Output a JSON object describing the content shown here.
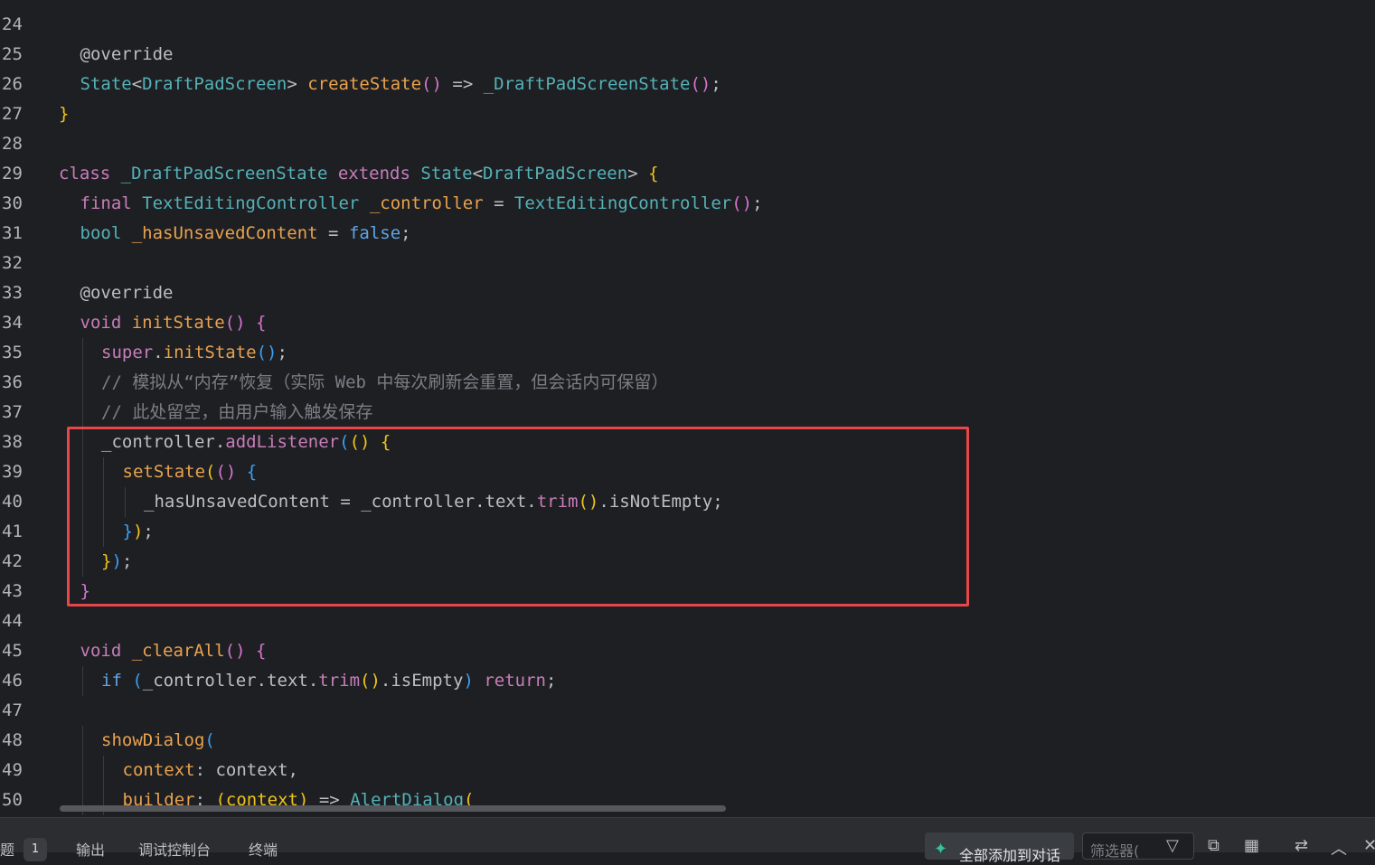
{
  "editor": {
    "lines": [
      {
        "num": "24",
        "indent": 0,
        "tokens": []
      },
      {
        "num": "25",
        "indent": 1,
        "tokens": [
          [
            "t-ann",
            "@override"
          ]
        ]
      },
      {
        "num": "26",
        "indent": 1,
        "tokens": [
          [
            "t-type",
            "State"
          ],
          [
            "t-op",
            "<"
          ],
          [
            "t-type",
            "DraftPadScreen"
          ],
          [
            "t-op",
            "> "
          ],
          [
            "t-call",
            "createState"
          ],
          [
            "t-p",
            "()"
          ],
          [
            "t-op",
            " => "
          ],
          [
            "t-type",
            "_DraftPadScreenState"
          ],
          [
            "t-p",
            "()"
          ],
          [
            "t-op",
            ";"
          ]
        ]
      },
      {
        "num": "27",
        "indent": 0,
        "tokens": [
          [
            "t-y",
            "}"
          ]
        ]
      },
      {
        "num": "28",
        "indent": 0,
        "tokens": []
      },
      {
        "num": "29",
        "indent": 0,
        "tokens": [
          [
            "t-kw",
            "class "
          ],
          [
            "t-type",
            "_DraftPadScreenState "
          ],
          [
            "t-kw",
            "extends "
          ],
          [
            "t-type",
            "State"
          ],
          [
            "t-op",
            "<"
          ],
          [
            "t-type",
            "DraftPadScreen"
          ],
          [
            "t-op",
            "> "
          ],
          [
            "t-y",
            "{"
          ]
        ]
      },
      {
        "num": "30",
        "indent": 1,
        "tokens": [
          [
            "t-kw",
            "final "
          ],
          [
            "t-type",
            "TextEditingController "
          ],
          [
            "t-named",
            "_controller"
          ],
          [
            "t-op",
            " = "
          ],
          [
            "t-type",
            "TextEditingController"
          ],
          [
            "t-p",
            "()"
          ],
          [
            "t-op",
            ";"
          ]
        ]
      },
      {
        "num": "31",
        "indent": 1,
        "tokens": [
          [
            "t-type",
            "bool "
          ],
          [
            "t-named",
            "_hasUnsavedContent"
          ],
          [
            "t-op",
            " = "
          ],
          [
            "t-kw2",
            "false"
          ],
          [
            "t-op",
            ";"
          ]
        ]
      },
      {
        "num": "32",
        "indent": 0,
        "tokens": []
      },
      {
        "num": "33",
        "indent": 1,
        "tokens": [
          [
            "t-ann",
            "@override"
          ]
        ]
      },
      {
        "num": "34",
        "indent": 1,
        "tokens": [
          [
            "t-kw",
            "void "
          ],
          [
            "t-call",
            "initState"
          ],
          [
            "t-p",
            "() "
          ],
          [
            "t-p",
            "{"
          ]
        ]
      },
      {
        "num": "35",
        "indent": 2,
        "tokens": [
          [
            "t-kw",
            "super"
          ],
          [
            "t-op",
            "."
          ],
          [
            "t-call",
            "initState"
          ],
          [
            "t-b",
            "()"
          ],
          [
            "t-op",
            ";"
          ]
        ]
      },
      {
        "num": "36",
        "indent": 2,
        "tokens": [
          [
            "t-comment",
            "// 模拟从“内存”恢复（实际 Web 中每次刷新会重置，但会话内可保留）"
          ]
        ]
      },
      {
        "num": "37",
        "indent": 2,
        "tokens": [
          [
            "t-comment",
            "// 此处留空，由用户输入触发保存"
          ]
        ]
      },
      {
        "num": "38",
        "indent": 2,
        "tokens": [
          [
            "t-field",
            "_controller"
          ],
          [
            "t-op",
            "."
          ],
          [
            "t-method",
            "addListener"
          ],
          [
            "t-b",
            "("
          ],
          [
            "t-y",
            "() {"
          ]
        ]
      },
      {
        "num": "39",
        "indent": 3,
        "tokens": [
          [
            "t-call",
            "setState"
          ],
          [
            "t-y",
            "("
          ],
          [
            "t-p",
            "() "
          ],
          [
            "t-b",
            "{"
          ]
        ]
      },
      {
        "num": "40",
        "indent": 4,
        "tokens": [
          [
            "t-field",
            "_hasUnsavedContent"
          ],
          [
            "t-op",
            " = "
          ],
          [
            "t-field",
            "_controller"
          ],
          [
            "t-op",
            ".text."
          ],
          [
            "t-method",
            "trim"
          ],
          [
            "t-y",
            "()"
          ],
          [
            "t-op",
            ".isNotEmpty;"
          ]
        ]
      },
      {
        "num": "41",
        "indent": 3,
        "tokens": [
          [
            "t-b",
            "}"
          ],
          [
            "t-y",
            ")"
          ],
          [
            "t-op",
            ";"
          ]
        ]
      },
      {
        "num": "42",
        "indent": 2,
        "tokens": [
          [
            "t-y",
            "}"
          ],
          [
            "t-b",
            ")"
          ],
          [
            "t-op",
            ";"
          ]
        ]
      },
      {
        "num": "43",
        "indent": 1,
        "tokens": [
          [
            "t-p",
            "}"
          ]
        ]
      },
      {
        "num": "44",
        "indent": 0,
        "tokens": []
      },
      {
        "num": "45",
        "indent": 1,
        "tokens": [
          [
            "t-kw",
            "void "
          ],
          [
            "t-call",
            "_clearAll"
          ],
          [
            "t-p",
            "() "
          ],
          [
            "t-p",
            "{"
          ]
        ]
      },
      {
        "num": "46",
        "indent": 2,
        "tokens": [
          [
            "t-kw2",
            "if "
          ],
          [
            "t-b",
            "("
          ],
          [
            "t-field",
            "_controller"
          ],
          [
            "t-op",
            ".text."
          ],
          [
            "t-method",
            "trim"
          ],
          [
            "t-y",
            "()"
          ],
          [
            "t-op",
            ".isEmpty"
          ],
          [
            "t-b",
            ")"
          ],
          [
            "t-kw",
            " return"
          ],
          [
            "t-op",
            ";"
          ]
        ]
      },
      {
        "num": "47",
        "indent": 0,
        "tokens": []
      },
      {
        "num": "48",
        "indent": 2,
        "tokens": [
          [
            "t-call",
            "showDialog"
          ],
          [
            "t-b",
            "("
          ]
        ]
      },
      {
        "num": "49",
        "indent": 3,
        "tokens": [
          [
            "t-named",
            "context"
          ],
          [
            "t-op",
            ": context,"
          ]
        ]
      },
      {
        "num": "50",
        "indent": 3,
        "tokens": [
          [
            "t-named",
            "builder"
          ],
          [
            "t-op",
            ": "
          ],
          [
            "t-y",
            "(context)"
          ],
          [
            "t-op",
            " => "
          ],
          [
            "t-type",
            "AlertDialog"
          ],
          [
            "t-y",
            "("
          ]
        ]
      }
    ]
  },
  "bottom_panel": {
    "tabs": [
      {
        "label": "题",
        "name": "tab-problems"
      },
      {
        "label": "输出",
        "name": "tab-output"
      },
      {
        "label": "调试控制台",
        "name": "tab-debug-console"
      },
      {
        "label": "终端",
        "name": "tab-terminal"
      }
    ],
    "problems_count": "1",
    "ai_button_label": "全部添加到对话",
    "ai_button_icon": "sparkle-icon",
    "filter_placeholder": "筛选器(",
    "icons": [
      "filter-icon",
      "copy-icon",
      "layout-icon",
      "link-icon",
      "chevron-up-icon",
      "close-icon"
    ],
    "colors": {
      "highlight_border": "#e8474a",
      "editor_bg": "#1e1f22",
      "panel_bg": "#2b2d30"
    }
  }
}
